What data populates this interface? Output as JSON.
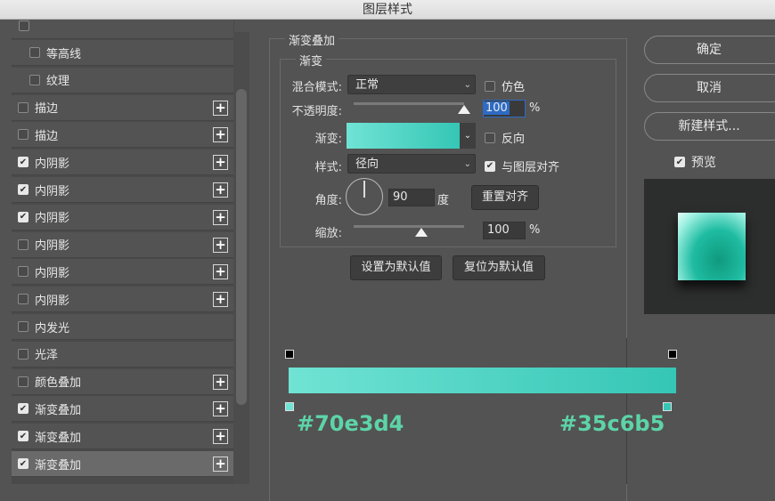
{
  "window": {
    "title": "图层样式"
  },
  "style_list": [
    {
      "label": "等高线",
      "checked": false,
      "plus": false,
      "indent": true
    },
    {
      "label": "纹理",
      "checked": false,
      "plus": false,
      "indent": true
    },
    {
      "label": "描边",
      "checked": false,
      "plus": true
    },
    {
      "label": "描边",
      "checked": false,
      "plus": true
    },
    {
      "label": "内阴影",
      "checked": true,
      "plus": true
    },
    {
      "label": "内阴影",
      "checked": true,
      "plus": true
    },
    {
      "label": "内阴影",
      "checked": true,
      "plus": true
    },
    {
      "label": "内阴影",
      "checked": false,
      "plus": true
    },
    {
      "label": "内阴影",
      "checked": false,
      "plus": true
    },
    {
      "label": "内阴影",
      "checked": false,
      "plus": true
    },
    {
      "label": "内发光",
      "checked": false,
      "plus": false
    },
    {
      "label": "光泽",
      "checked": false,
      "plus": false
    },
    {
      "label": "颜色叠加",
      "checked": false,
      "plus": true
    },
    {
      "label": "渐变叠加",
      "checked": true,
      "plus": true
    },
    {
      "label": "渐变叠加",
      "checked": true,
      "plus": true
    },
    {
      "label": "渐变叠加",
      "checked": true,
      "plus": true,
      "selected": true
    }
  ],
  "panel": {
    "title": "渐变叠加",
    "group": "渐变",
    "blend_label": "混合模式:",
    "blend_value": "正常",
    "dither_label": "仿色",
    "dither": false,
    "opacity_label": "不透明度:",
    "opacity": "100",
    "opacity_unit": "%",
    "gradient_label": "渐变:",
    "reverse_label": "反向",
    "reverse": false,
    "style_label": "样式:",
    "style_value": "径向",
    "align_label": "与图层对齐",
    "align": true,
    "angle_label": "角度:",
    "angle": "90",
    "angle_unit": "度",
    "reset_align": "重置对齐",
    "scale_label": "缩放:",
    "scale": "100",
    "scale_unit": "%",
    "make_default": "设置为默认值",
    "reset_default": "复位为默认值"
  },
  "actions": {
    "ok": "确定",
    "cancel": "取消",
    "new_style": "新建样式...",
    "preview_label": "预览",
    "preview": true
  },
  "gradient": {
    "start": "#70e3d4",
    "end": "#35c6b5",
    "start_label": "#70e3d4",
    "end_label": "#35c6b5"
  }
}
